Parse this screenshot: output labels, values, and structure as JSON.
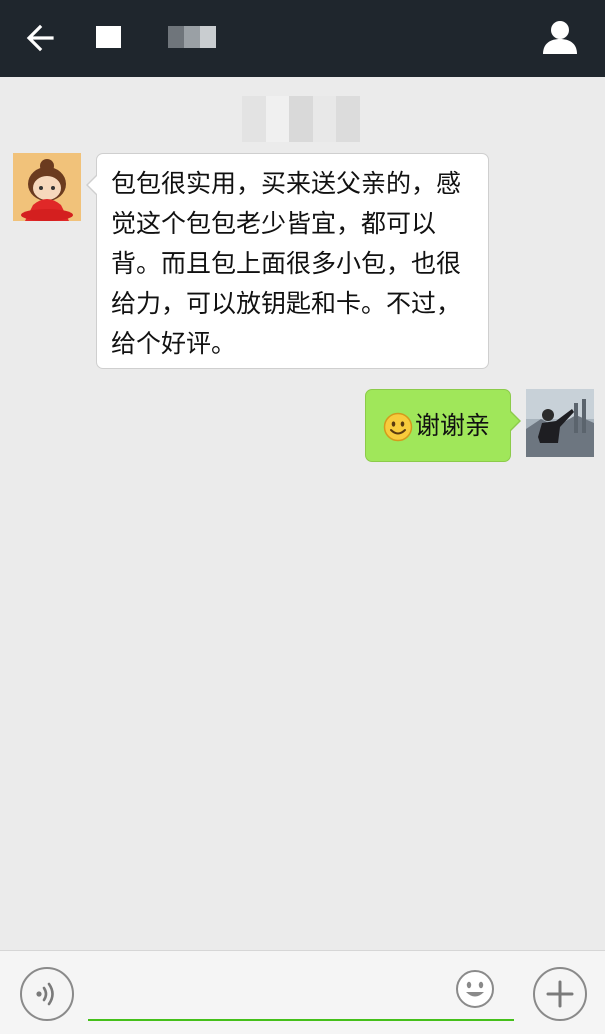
{
  "header": {
    "back_icon": "arrow-left-icon",
    "profile_icon": "person-icon"
  },
  "messages": [
    {
      "sender": "other",
      "text": "包包很实用，买来送父亲的，感觉这个包包老少皆宜，都可以背。而且包上面很多小包，也很给力，可以放钥匙和卡。不过，给个好评。"
    },
    {
      "sender": "me",
      "emoji": "smiley-emoji-icon",
      "text": "谢谢亲"
    }
  ],
  "input_bar": {
    "voice_icon": "voice-icon",
    "text_value": "",
    "emoji_icon": "smiley-icon",
    "plus_icon": "plus-icon"
  },
  "colors": {
    "topbar": "#1f262d",
    "background": "#ebebeb",
    "outgoing_bubble": "#a0e75a",
    "incoming_bubble": "#ffffff",
    "input_underline": "#45c01a"
  }
}
